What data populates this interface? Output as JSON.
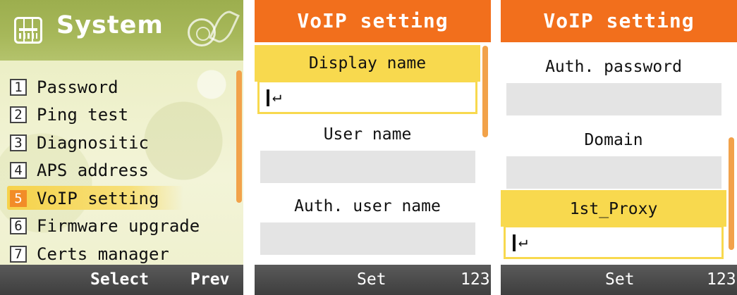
{
  "screen1": {
    "title": "System",
    "menu": [
      {
        "num": "1",
        "label": "Password"
      },
      {
        "num": "2",
        "label": "Ping test"
      },
      {
        "num": "3",
        "label": "Diagnositic"
      },
      {
        "num": "4",
        "label": "APS address"
      },
      {
        "num": "5",
        "label": "VoIP setting"
      },
      {
        "num": "6",
        "label": "Firmware upgrade"
      },
      {
        "num": "7",
        "label": "Certs manager"
      }
    ],
    "selected_index": 4,
    "softkeys": {
      "left": "Select",
      "right": "Prev"
    }
  },
  "screen2": {
    "title": "VoIP setting",
    "fields": [
      {
        "label": "Display name",
        "value": ""
      },
      {
        "label": "User name",
        "value": ""
      },
      {
        "label": "Auth. user name",
        "value": ""
      }
    ],
    "softkeys": {
      "center": "Set",
      "right": "123"
    }
  },
  "screen3": {
    "title": "VoIP setting",
    "fields": [
      {
        "label": "Auth. password",
        "value": ""
      },
      {
        "label": "Domain",
        "value": ""
      },
      {
        "label": "1st_Proxy",
        "value": ""
      }
    ],
    "softkeys": {
      "center": "Set",
      "right": "123"
    }
  },
  "colors": {
    "header_orange": "#f26f1c",
    "highlight_yellow": "#f8d94e",
    "scroll_orange": "#f2a24a",
    "softbar": "#4a4a4a"
  }
}
